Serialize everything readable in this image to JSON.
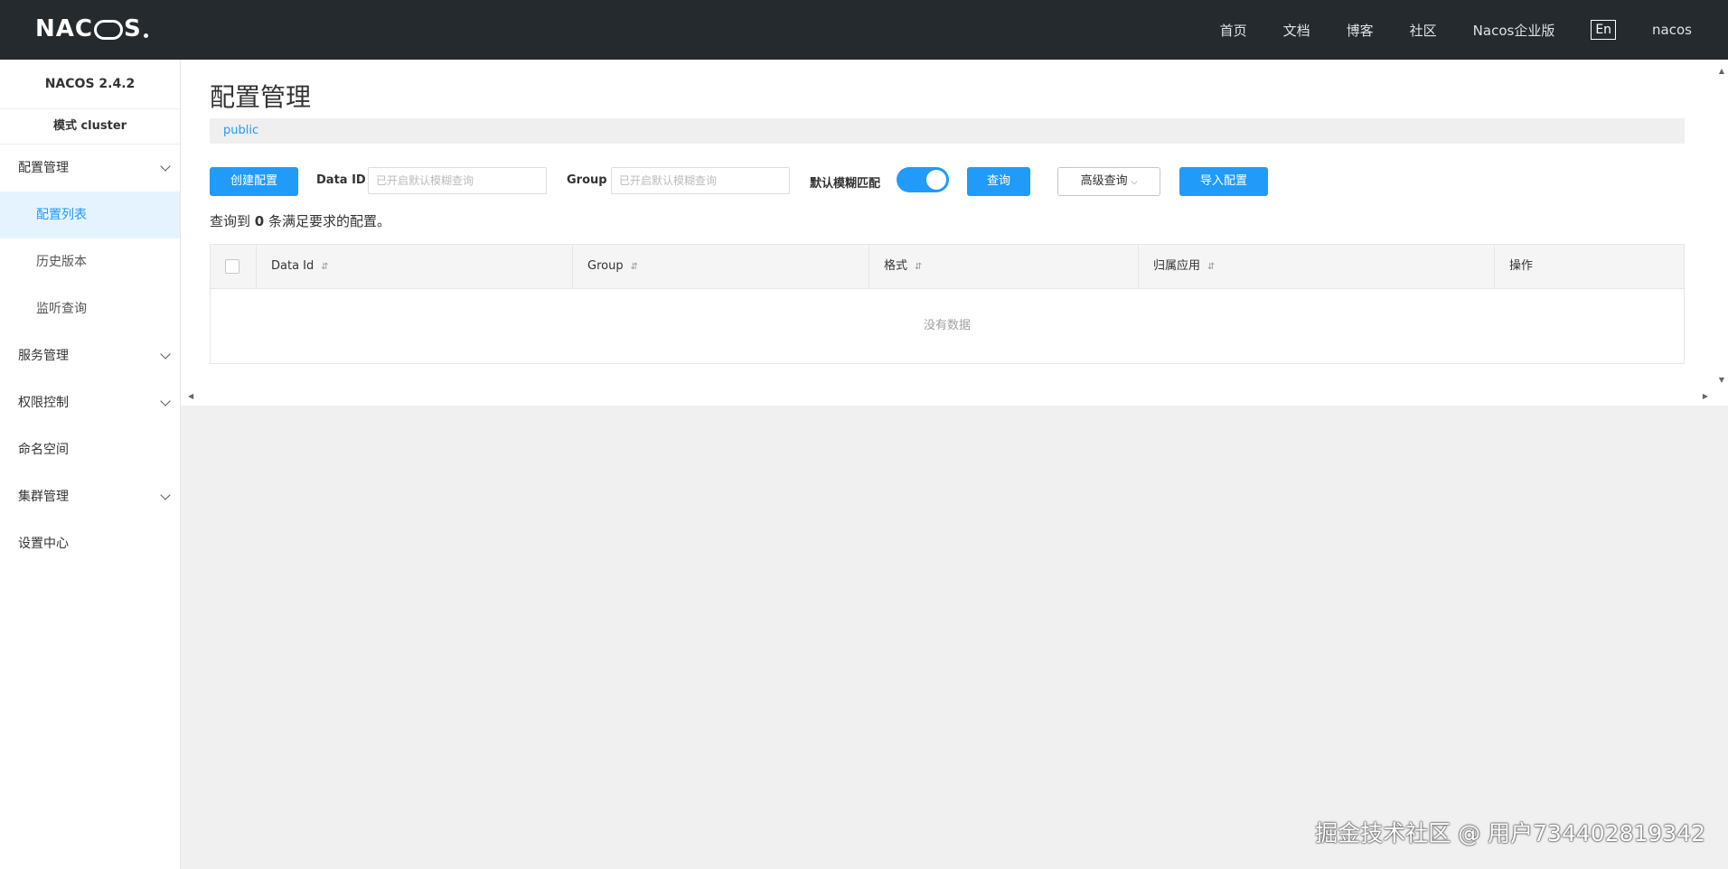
{
  "header": {
    "logo": "NACOS.",
    "nav": [
      "首页",
      "文档",
      "博客",
      "社区",
      "Nacos企业版"
    ],
    "lang": "En",
    "user": "nacos"
  },
  "sidebar": {
    "version": "NACOS 2.4.2",
    "mode": "模式 cluster",
    "groups": [
      {
        "label": "配置管理",
        "expanded": true,
        "children": [
          "配置列表",
          "历史版本",
          "监听查询"
        ],
        "active_child": "配置列表"
      },
      {
        "label": "服务管理",
        "expanded": false
      },
      {
        "label": "权限控制",
        "expanded": false
      },
      {
        "label": "命名空间"
      },
      {
        "label": "集群管理",
        "expanded": false
      },
      {
        "label": "设置中心"
      }
    ]
  },
  "main": {
    "title": "配置管理",
    "namespace": "public",
    "toolbar": {
      "create_label": "创建配置",
      "dataid_label": "Data ID",
      "dataid_placeholder": "已开启默认模糊查询",
      "group_label": "Group",
      "group_placeholder": "已开启默认模糊查询",
      "fuzzy_label": "默认模糊匹配",
      "fuzzy_on": true,
      "query_label": "查询",
      "advanced_label": "高级查询",
      "import_label": "导入配置"
    },
    "result": {
      "prefix": "查询到",
      "count": "0",
      "suffix": "条满足要求的配置。"
    },
    "table": {
      "columns": [
        "Data Id",
        "Group",
        "格式",
        "归属应用",
        "操作"
      ],
      "empty_text": "没有数据"
    }
  },
  "watermark": "掘金技术社区 @ 用户734402819342"
}
